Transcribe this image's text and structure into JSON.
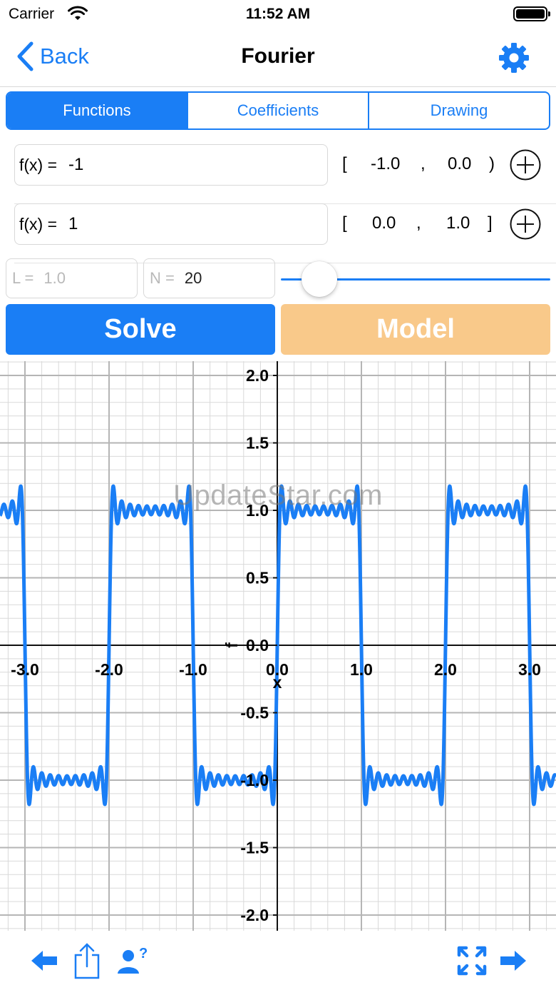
{
  "status_bar": {
    "carrier": "Carrier",
    "time": "11:52 AM"
  },
  "nav": {
    "back_label": "Back",
    "title": "Fourier",
    "settings_icon": "gear-icon"
  },
  "tabs": [
    {
      "label": "Functions",
      "active": true
    },
    {
      "label": "Coefficients",
      "active": false
    },
    {
      "label": "Drawing",
      "active": false
    }
  ],
  "functions": [
    {
      "label": "f(x) =",
      "expression": "-1",
      "open_bracket": "[",
      "start": "-1.0",
      "comma": ",",
      "end": "0.0",
      "close_bracket": ")"
    },
    {
      "label": "f(x) =",
      "expression": "1",
      "open_bracket": "[",
      "start": "0.0",
      "comma": ",",
      "end": "1.0",
      "close_bracket": "]"
    }
  ],
  "params": {
    "L_label": "L =",
    "L_value": "1.0",
    "N_label": "N =",
    "N_value": "20",
    "slider_fraction": 0.1
  },
  "buttons": {
    "solve": "Solve",
    "model": "Model"
  },
  "colors": {
    "accent": "#1a7ef5",
    "model_button": "#f9c98a",
    "curve": "#1a7ef5",
    "grid": "#d9d9d9",
    "grid_major": "#b5b5b5"
  },
  "watermark": "UpdateStar.com",
  "chart_data": {
    "type": "line",
    "title": "",
    "xlabel": "x",
    "ylabel": "f",
    "xlim": [
      -3.3,
      3.3
    ],
    "ylim": [
      -2.1,
      2.1
    ],
    "grid": true,
    "x_tick_labels": [
      "-3.0",
      "-2.0",
      "-1.0",
      "0.0",
      "1.0",
      "2.0",
      "3.0"
    ],
    "y_tick_labels": [
      "2.0",
      "1.5",
      "1.0",
      "0.5",
      "0.0",
      "-0.5",
      "-1.0",
      "-1.5",
      "-2.0"
    ],
    "series": [
      {
        "function": "Fourier series partial sum of square wave (-1 on [-1,0), 1 on [0,1]), period 2",
        "terms": 20
      }
    ]
  },
  "toolbar": {
    "left": [
      "arrow-left-icon",
      "share-icon",
      "help-user-icon"
    ],
    "right": [
      "expand-icon",
      "arrow-right-icon"
    ]
  }
}
